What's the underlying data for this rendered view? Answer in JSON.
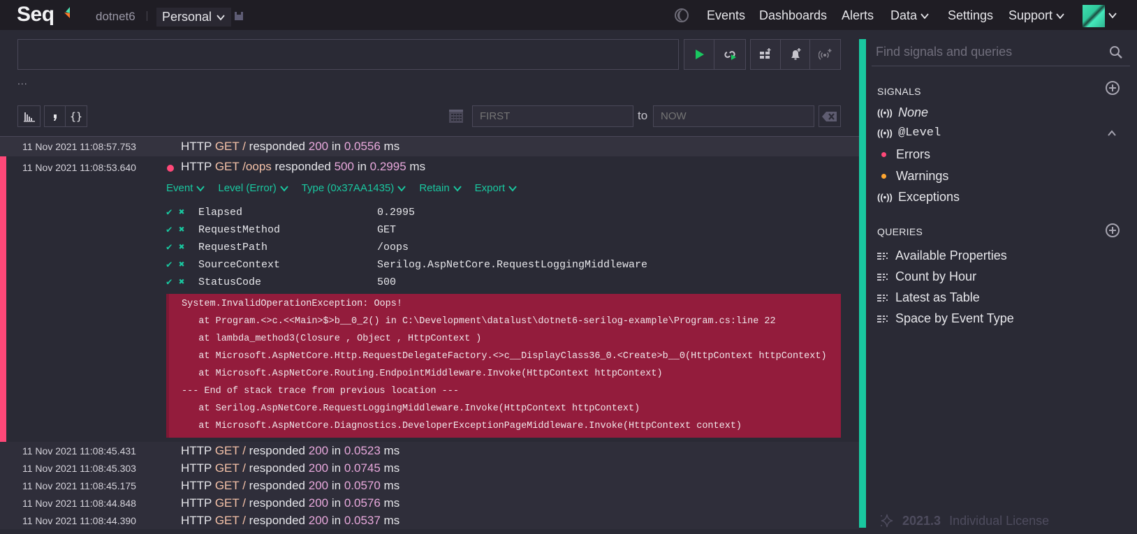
{
  "header": {
    "logo": "Seq",
    "instance": "dotnet6",
    "workspace": "Personal",
    "nav": [
      {
        "label": "Events",
        "dropdown": false
      },
      {
        "label": "Dashboards",
        "dropdown": false
      },
      {
        "label": "Alerts",
        "dropdown": false
      },
      {
        "label": "Data",
        "dropdown": true
      },
      {
        "label": "Settings",
        "dropdown": false
      },
      {
        "label": "Support",
        "dropdown": true
      }
    ]
  },
  "toolbar": {
    "query_value": "",
    "ellipsis": "...",
    "icons": [
      "play-icon",
      "refresh-play-icon",
      "add-dashboard-icon",
      "add-alert-icon",
      "add-signal-icon"
    ]
  },
  "range": {
    "from_placeholder": "FIRST",
    "to_label": "to",
    "to_placeholder": "NOW"
  },
  "events": {
    "before": [
      {
        "ts": "11 Nov 2021  11:08:57.753",
        "method": "GET",
        "path": "/",
        "status": "200",
        "elapsed": "0.0556"
      }
    ],
    "expanded": {
      "ts": "11 Nov 2021  11:08:53.640",
      "method": "GET",
      "path": "/oops",
      "status": "500",
      "elapsed": "0.2995",
      "level_color": "#ff4878",
      "actions": [
        "Event",
        "Level (Error)",
        "Type (0x37AA1435)",
        "Retain",
        "Export"
      ],
      "properties": [
        {
          "name": "Elapsed",
          "value": "0.2995"
        },
        {
          "name": "RequestMethod",
          "value": "GET"
        },
        {
          "name": "RequestPath",
          "value": "/oops"
        },
        {
          "name": "SourceContext",
          "value": "Serilog.AspNetCore.RequestLoggingMiddleware"
        },
        {
          "name": "StatusCode",
          "value": "500"
        }
      ],
      "exception": [
        "System.InvalidOperationException: Oops!",
        "   at Program.<>c.<<Main>$>b__0_2() in C:\\Development\\datalust\\dotnet6-serilog-example\\Program.cs:line 22",
        "   at lambda_method3(Closure , Object , HttpContext )",
        "   at Microsoft.AspNetCore.Http.RequestDelegateFactory.<>c__DisplayClass36_0.<Create>b__0(HttpContext httpContext)",
        "   at Microsoft.AspNetCore.Routing.EndpointMiddleware.Invoke(HttpContext httpContext)",
        "--- End of stack trace from previous location ---",
        "   at Serilog.AspNetCore.RequestLoggingMiddleware.Invoke(HttpContext httpContext)",
        "   at Microsoft.AspNetCore.Diagnostics.DeveloperExceptionPageMiddleware.Invoke(HttpContext context)"
      ]
    },
    "after": [
      {
        "ts": "11 Nov 2021  11:08:45.431",
        "method": "GET",
        "path": "/",
        "status": "200",
        "elapsed": "0.0523"
      },
      {
        "ts": "11 Nov 2021  11:08:45.303",
        "method": "GET",
        "path": "/",
        "status": "200",
        "elapsed": "0.0745"
      },
      {
        "ts": "11 Nov 2021  11:08:45.175",
        "method": "GET",
        "path": "/",
        "status": "200",
        "elapsed": "0.0570"
      },
      {
        "ts": "11 Nov 2021  11:08:44.848",
        "method": "GET",
        "path": "/",
        "status": "200",
        "elapsed": "0.0576"
      },
      {
        "ts": "11 Nov 2021  11:08:44.390",
        "method": "GET",
        "path": "/",
        "status": "200",
        "elapsed": "0.0537"
      }
    ],
    "msg_parts": {
      "http": "HTTP",
      "responded": "responded",
      "in": "in",
      "ms": "ms"
    }
  },
  "sidebar": {
    "search_placeholder": "Find signals and queries",
    "signals_title": "SIGNALS",
    "signals": [
      {
        "label": "None",
        "style": "italic"
      },
      {
        "label": "@Level",
        "style": "mono"
      }
    ],
    "level_subs": [
      {
        "label": "Errors",
        "color": "#ff4878"
      },
      {
        "label": "Warnings",
        "color": "#ffa630"
      }
    ],
    "exceptions_label": "Exceptions",
    "queries_title": "QUERIES",
    "queries": [
      "Available Properties",
      "Count by Hour",
      "Latest as Table",
      "Space by Event Type"
    ],
    "version": "2021.3",
    "license": "Individual License"
  },
  "colors": {
    "accent": "#19c8a0",
    "error": "#ff4878",
    "warning": "#ffa630",
    "exception_bg": "#931c3c",
    "play": "#19c860"
  }
}
